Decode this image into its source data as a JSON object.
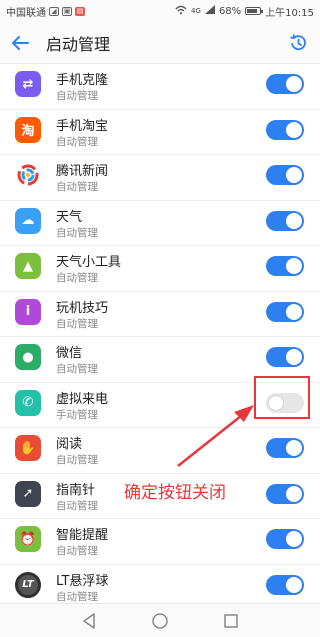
{
  "status_bar": {
    "carrier": "中国联通",
    "net_badge": "4G",
    "battery": "68%",
    "time": "上午10:15"
  },
  "header": {
    "title": "启动管理"
  },
  "apps": [
    {
      "name": "手机克隆",
      "mode": "自动管理",
      "on": true,
      "icon": "phone-clone-icon",
      "color": "#7b5cf0",
      "glyph": "⇄"
    },
    {
      "name": "手机淘宝",
      "mode": "自动管理",
      "on": true,
      "icon": "taobao-icon",
      "color": "#ff5a00",
      "glyph": "淘"
    },
    {
      "name": "腾讯新闻",
      "mode": "自动管理",
      "on": true,
      "icon": "tencent-news-icon",
      "color": "#ffffff",
      "glyph": ""
    },
    {
      "name": "天气",
      "mode": "自动管理",
      "on": true,
      "icon": "weather-icon",
      "color": "#3aa0f5",
      "glyph": "☁"
    },
    {
      "name": "天气小工具",
      "mode": "自动管理",
      "on": true,
      "icon": "android-icon",
      "color": "#7cbf3c",
      "glyph": "▲"
    },
    {
      "name": "玩机技巧",
      "mode": "自动管理",
      "on": true,
      "icon": "tips-icon",
      "color": "#b048d8",
      "glyph": "i"
    },
    {
      "name": "微信",
      "mode": "自动管理",
      "on": true,
      "icon": "wechat-icon",
      "color": "#2aae67",
      "glyph": "●"
    },
    {
      "name": "虚拟来电",
      "mode": "手动管理",
      "on": false,
      "icon": "fake-call-icon",
      "color": "#24c1a8",
      "glyph": "✆"
    },
    {
      "name": "阅读",
      "mode": "自动管理",
      "on": true,
      "icon": "reading-icon",
      "color": "#ea4b35",
      "glyph": "✋"
    },
    {
      "name": "指南针",
      "mode": "自动管理",
      "on": true,
      "icon": "compass-icon",
      "color": "#3f4450",
      "glyph": "➚"
    },
    {
      "name": "智能提醒",
      "mode": "自动管理",
      "on": true,
      "icon": "android-reminder-icon",
      "color": "#7cbf3c",
      "glyph": "⏰"
    },
    {
      "name": "LT悬浮球",
      "mode": "自动管理",
      "on": true,
      "icon": "floating-ball-icon",
      "color": "#3b3b3b",
      "glyph": "LT"
    }
  ],
  "annotation": {
    "text": "确定按钮关闭",
    "color": "#e8373a"
  },
  "colors": {
    "accent": "#2e7ff0"
  }
}
